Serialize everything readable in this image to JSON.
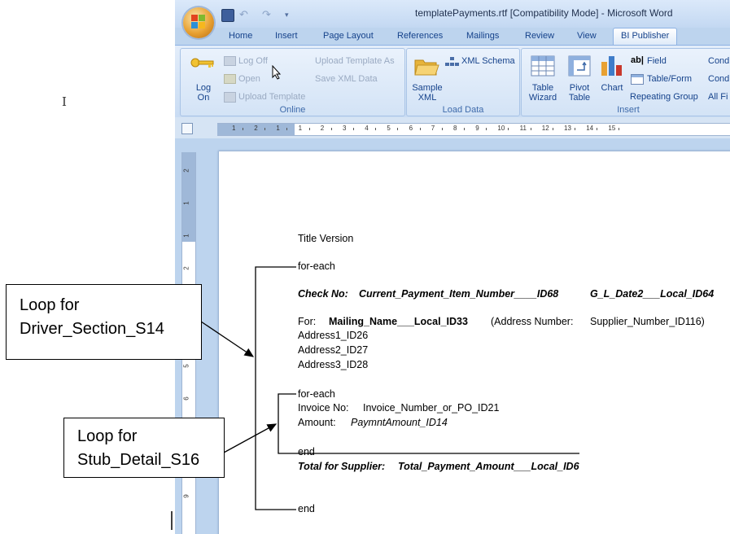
{
  "window": {
    "title": "templatePayments.rtf [Compatibility Mode] - Microsoft Word"
  },
  "tabs": [
    "Home",
    "Insert",
    "Page Layout",
    "References",
    "Mailings",
    "Review",
    "View",
    "BI Publisher"
  ],
  "active_tab": "BI Publisher",
  "ribbon": {
    "online": {
      "label": "Online",
      "log_on": "Log On",
      "log_off": "Log Off",
      "open": "Open",
      "upload_template": "Upload Template",
      "upload_template_as": "Upload Template As",
      "save_xml_data": "Save XML Data"
    },
    "load_data": {
      "label": "Load Data",
      "sample_xml": "Sample XML",
      "xml_schema": "XML Schema"
    },
    "insert": {
      "label": "Insert",
      "table_wizard": "Table Wizard",
      "pivot_table": "Pivot Table",
      "chart": "Chart",
      "field": "Field",
      "table_form": "Table/Form",
      "repeating_group": "Repeating Group",
      "cond1": "Cond",
      "cond2": "Cond",
      "all_fi": "All Fi"
    }
  },
  "ruler_numbers": [
    "1",
    "2",
    "1",
    "1",
    "2",
    "3",
    "4",
    "5",
    "6",
    "7",
    "8",
    "9",
    "10",
    "11",
    "12",
    "13",
    "14",
    "15"
  ],
  "vruler_numbers": [
    "2",
    "1",
    "1",
    "2",
    "3",
    "4",
    "5",
    "6",
    "7",
    "8",
    "9"
  ],
  "document": {
    "title_version": "Title Version",
    "for_each_1": "for-each",
    "check_no_label": "Check No:",
    "check_no_field": "Current_Payment_Item_Number____ID68",
    "date_field": "G_L_Date2___Local_ID64",
    "for_label": "For:",
    "mailing_name": "Mailing_Name___Local_ID33",
    "address_number_label": "(Address Number:",
    "supplier_number": "Supplier_Number_ID116)",
    "address1": "Address1_ID26",
    "address2": "Address2_ID27",
    "address3": "Address3_ID28",
    "for_each_2": "for-each",
    "invoice_no_label": "Invoice No:",
    "invoice_no_field": "Invoice_Number_or_PO_ID21",
    "amount_label": "Amount:",
    "amount_field": "PaymntAmount_ID14",
    "end_inner": "end",
    "total_label": "Total for Supplier:",
    "total_field": "Total_Payment_Amount___Local_ID6",
    "end_outer": "end"
  },
  "callouts": {
    "driver": {
      "line1": "Loop for",
      "line2": "Driver_Section_S14"
    },
    "stub": {
      "line1": "Loop for",
      "line2": "Stub_Detail_S16"
    }
  },
  "colors": {
    "accent": "#15428b",
    "ribbon": "#dbe8f8",
    "window": "#bdd4ee"
  }
}
